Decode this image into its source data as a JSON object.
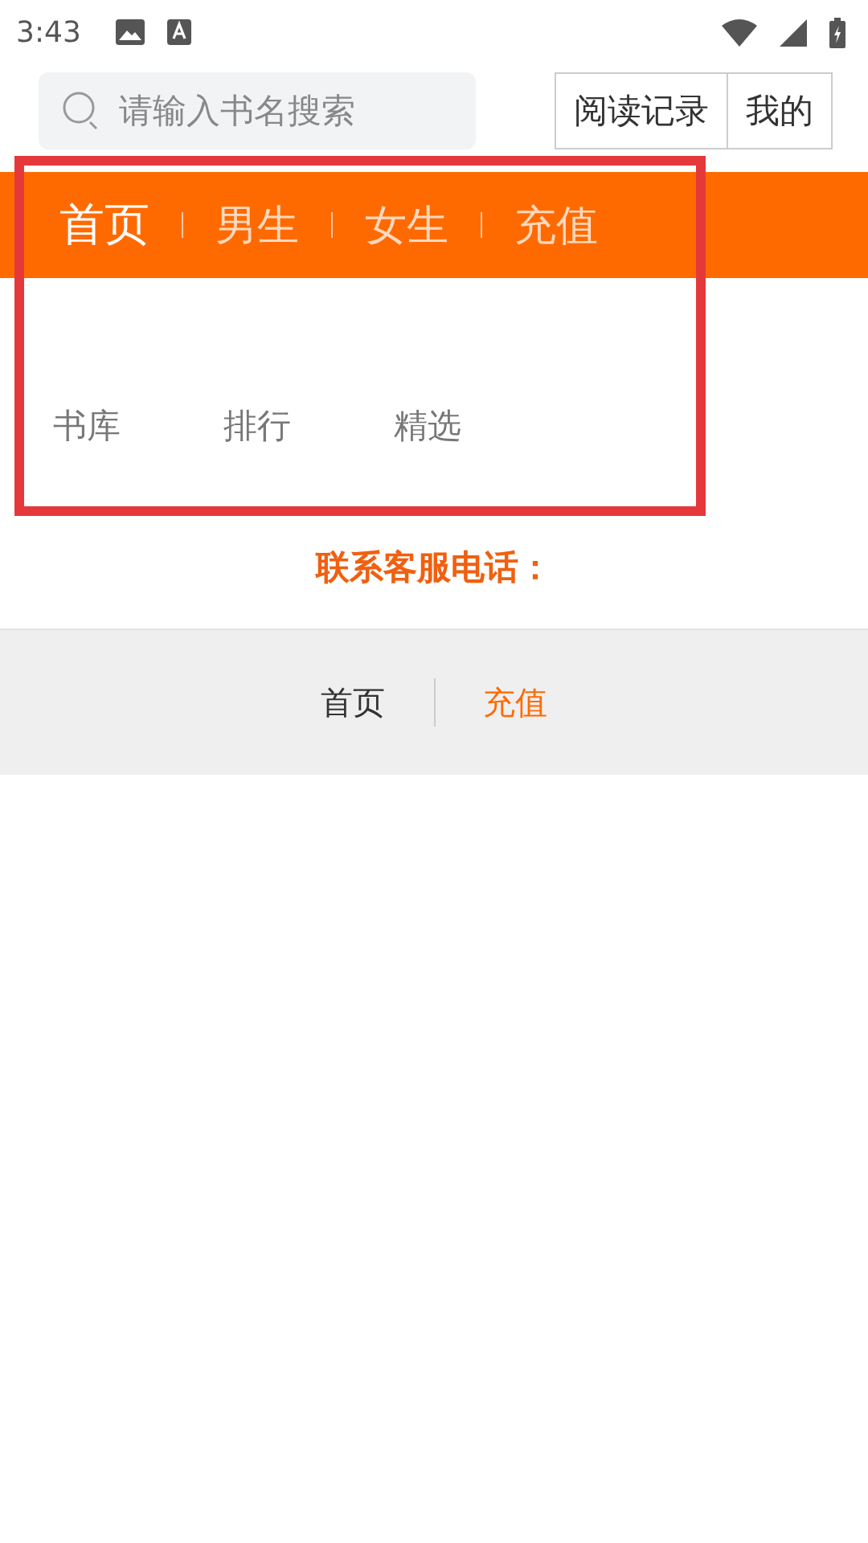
{
  "status_bar": {
    "time": "3:43"
  },
  "search": {
    "placeholder": "请输入书名搜索"
  },
  "top_buttons": [
    "阅读记录",
    "我的"
  ],
  "tabs": [
    {
      "label": "首页",
      "selected": true
    },
    {
      "label": "男生",
      "selected": false
    },
    {
      "label": "女生",
      "selected": false
    },
    {
      "label": "充值",
      "selected": false
    }
  ],
  "sub_nav": [
    "书库",
    "排行",
    "精选"
  ],
  "contact": "联系客服电话：",
  "footer_links": [
    {
      "label": "首页",
      "kind": "plain"
    },
    {
      "label": "充值",
      "kind": "accent"
    }
  ]
}
